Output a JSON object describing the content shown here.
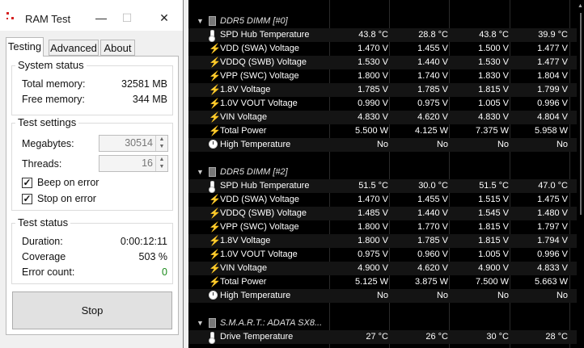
{
  "window": {
    "title": "RAM Test",
    "minimize_glyph": "—",
    "maximize_glyph": "☐",
    "close_glyph": "✕"
  },
  "tabs": [
    {
      "label": "Testing"
    },
    {
      "label": "Advanced"
    },
    {
      "label": "About"
    }
  ],
  "system_status": {
    "title": "System status",
    "total_label": "Total memory:",
    "total_value": "32581 MB",
    "free_label": "Free memory:",
    "free_value": "344 MB"
  },
  "test_settings": {
    "title": "Test settings",
    "megabytes_label": "Megabytes:",
    "megabytes_value": "30514",
    "threads_label": "Threads:",
    "threads_value": "16",
    "beep_label": "Beep on error",
    "beep_checked": true,
    "stop_label": "Stop on error",
    "stop_checked": true
  },
  "test_status": {
    "title": "Test status",
    "duration_label": "Duration:",
    "duration_value": "0:00:12:11",
    "coverage_label": "Coverage",
    "coverage_value": "503 %",
    "errors_label": "Error count:",
    "errors_value": "0",
    "errors_color": "#1a8a1a"
  },
  "stop_button": {
    "label": "Stop"
  },
  "sensors": {
    "bolt_color": "#f3b61c",
    "groups": [
      {
        "name": "DDR5 DIMM [#0]",
        "rows": [
          {
            "icon": "thermometer-icon",
            "name": "SPD Hub Temperature",
            "values": [
              "43.8 °C",
              "28.8 °C",
              "43.8 °C",
              "39.9 °C"
            ]
          },
          {
            "icon": "bolt-icon",
            "name": "VDD (SWA) Voltage",
            "values": [
              "1.470 V",
              "1.455 V",
              "1.500 V",
              "1.477 V"
            ]
          },
          {
            "icon": "bolt-icon",
            "name": "VDDQ (SWB) Voltage",
            "values": [
              "1.530 V",
              "1.440 V",
              "1.530 V",
              "1.477 V"
            ]
          },
          {
            "icon": "bolt-icon",
            "name": "VPP (SWC) Voltage",
            "values": [
              "1.800 V",
              "1.740 V",
              "1.830 V",
              "1.804 V"
            ]
          },
          {
            "icon": "bolt-icon",
            "name": "1.8V Voltage",
            "values": [
              "1.785 V",
              "1.785 V",
              "1.815 V",
              "1.799 V"
            ]
          },
          {
            "icon": "bolt-icon",
            "name": "1.0V VOUT Voltage",
            "values": [
              "0.990 V",
              "0.975 V",
              "1.005 V",
              "0.996 V"
            ]
          },
          {
            "icon": "bolt-icon",
            "name": "VIN Voltage",
            "values": [
              "4.830 V",
              "4.620 V",
              "4.830 V",
              "4.804 V"
            ]
          },
          {
            "icon": "bolt-icon",
            "name": "Total Power",
            "values": [
              "5.500 W",
              "4.125 W",
              "7.375 W",
              "5.958 W"
            ]
          },
          {
            "icon": "clock-icon",
            "name": "High Temperature",
            "values": [
              "No",
              "No",
              "No",
              "No"
            ]
          }
        ]
      },
      {
        "name": "DDR5 DIMM [#2]",
        "rows": [
          {
            "icon": "thermometer-icon",
            "name": "SPD Hub Temperature",
            "values": [
              "51.5 °C",
              "30.0 °C",
              "51.5 °C",
              "47.0 °C"
            ]
          },
          {
            "icon": "bolt-icon",
            "name": "VDD (SWA) Voltage",
            "values": [
              "1.470 V",
              "1.455 V",
              "1.515 V",
              "1.475 V"
            ]
          },
          {
            "icon": "bolt-icon",
            "name": "VDDQ (SWB) Voltage",
            "values": [
              "1.485 V",
              "1.440 V",
              "1.545 V",
              "1.480 V"
            ]
          },
          {
            "icon": "bolt-icon",
            "name": "VPP (SWC) Voltage",
            "values": [
              "1.800 V",
              "1.770 V",
              "1.815 V",
              "1.797 V"
            ]
          },
          {
            "icon": "bolt-icon",
            "name": "1.8V Voltage",
            "values": [
              "1.800 V",
              "1.785 V",
              "1.815 V",
              "1.794 V"
            ]
          },
          {
            "icon": "bolt-icon",
            "name": "1.0V VOUT Voltage",
            "values": [
              "0.975 V",
              "0.960 V",
              "1.005 V",
              "0.996 V"
            ]
          },
          {
            "icon": "bolt-icon",
            "name": "VIN Voltage",
            "values": [
              "4.900 V",
              "4.620 V",
              "4.900 V",
              "4.833 V"
            ]
          },
          {
            "icon": "bolt-icon",
            "name": "Total Power",
            "values": [
              "5.125 W",
              "3.875 W",
              "7.500 W",
              "5.663 W"
            ]
          },
          {
            "icon": "clock-icon",
            "name": "High Temperature",
            "values": [
              "No",
              "No",
              "No",
              "No"
            ]
          }
        ]
      },
      {
        "name": "S.M.A.R.T.: ADATA SX8...",
        "rows": [
          {
            "icon": "thermometer-icon",
            "name": "Drive Temperature",
            "values": [
              "27 °C",
              "26 °C",
              "30 °C",
              "28 °C"
            ]
          }
        ]
      }
    ]
  }
}
